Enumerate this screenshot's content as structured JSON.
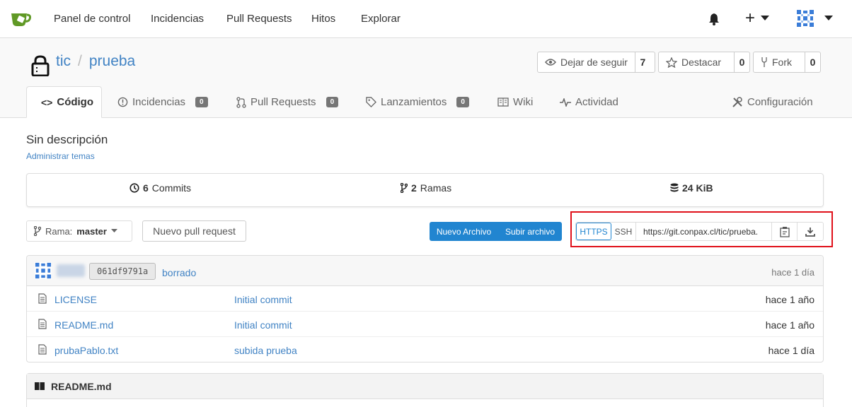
{
  "nav": {
    "items": [
      "Panel de control",
      "Incidencias",
      "Pull Requests",
      "Hitos",
      "Explorar"
    ],
    "plus": "+",
    "brand_color": "#609926"
  },
  "repo": {
    "owner": "tic",
    "separator": "/",
    "name": "prueba",
    "watch": {
      "label": "Dejar de seguir",
      "count": "7"
    },
    "star": {
      "label": "Destacar",
      "count": "0"
    },
    "fork": {
      "label": "Fork",
      "count": "0"
    }
  },
  "tabs": [
    {
      "label": "Código",
      "active": true
    },
    {
      "label": "Incidencias",
      "count": "0"
    },
    {
      "label": "Pull Requests",
      "count": "0"
    },
    {
      "label": "Lanzamientos",
      "count": "0"
    },
    {
      "label": "Wiki"
    },
    {
      "label": "Actividad"
    },
    {
      "label": "Configuración"
    }
  ],
  "description": "Sin descripción",
  "manage_topics": "Administrar temas",
  "stats": {
    "commits_count": "6",
    "commits_label": "Commits",
    "branches_count": "2",
    "branches_label": "Ramas",
    "size": "24 KiB"
  },
  "branch": {
    "prefix": "Rama:",
    "name": "master"
  },
  "new_pr": "Nuevo pull request",
  "new_file": "Nuevo Archivo",
  "upload_file": "Subir archivo",
  "clone": {
    "https": "HTTPS",
    "ssh": "SSH",
    "url": "https://git.conpax.cl/tic/prueba."
  },
  "latest_commit": {
    "sha": "061df9791a",
    "message": "borrado",
    "time": "hace 1 día"
  },
  "files": [
    {
      "name": "LICENSE",
      "commit": "Initial commit",
      "time": "hace 1 año"
    },
    {
      "name": "README.md",
      "commit": "Initial commit",
      "time": "hace 1 año"
    },
    {
      "name": "prubaPablo.txt",
      "commit": "subida prueba",
      "time": "hace 1 día"
    }
  ],
  "readme_title": "README.md"
}
